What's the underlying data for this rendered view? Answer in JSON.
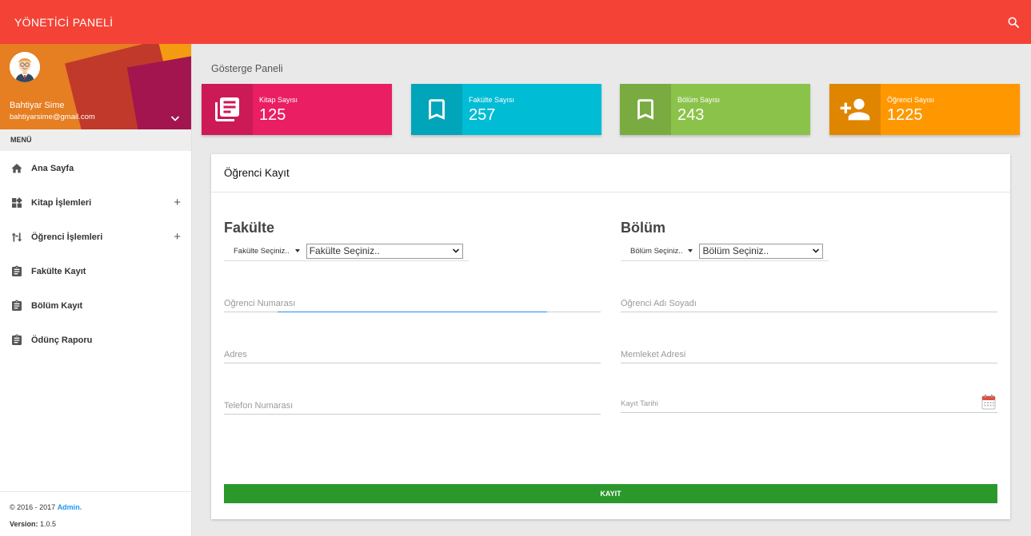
{
  "colors": {
    "topbar": "#f44336",
    "kitap": "#e91e63",
    "fakulte": "#00bcd4",
    "bolum": "#8bc34a",
    "ogrenci": "#ff9800",
    "button": "#2b982b",
    "link": "#2196f3"
  },
  "header": {
    "title": "YÖNETİCİ PANELİ",
    "search_icon": "search-icon"
  },
  "user": {
    "name": "Bahtiyar Sime",
    "email": "bahtiyarsime@gmail.com"
  },
  "menu": {
    "header": "MENÜ",
    "items": [
      {
        "label": "Ana Sayfa",
        "icon": "home-icon"
      },
      {
        "label": "Kitap İşlemleri",
        "icon": "widgets-icon",
        "expand": "+"
      },
      {
        "label": "Öğrenci İşlemleri",
        "icon": "swap-icon",
        "expand": "+"
      },
      {
        "label": "Fakülte Kayıt",
        "icon": "clipboard-icon"
      },
      {
        "label": "Bölüm Kayıt",
        "icon": "clipboard-icon"
      },
      {
        "label": "Ödünç Raporu",
        "icon": "clipboard-icon"
      }
    ]
  },
  "footer": {
    "copyright": "© 2016 - 2017 ",
    "link": "Admin.",
    "version_label": "Version: ",
    "version": "1.0.5"
  },
  "page_title": "Gösterge Paneli",
  "stats": [
    {
      "label": "Kitap Sayısı",
      "value": "125",
      "icon": "book-icon"
    },
    {
      "label": "Fakülte Sayısı",
      "value": "257",
      "icon": "bookmark-icon"
    },
    {
      "label": "Bölüm Sayısı",
      "value": "243",
      "icon": "bookmark-icon"
    },
    {
      "label": "Öğrenci Sayısı",
      "value": "1225",
      "icon": "person-add-icon"
    }
  ],
  "form": {
    "title": "Öğrenci Kayıt",
    "fakulte": {
      "title": "Fakülte",
      "bootstrap_select": "Fakülte Seçiniz..",
      "native_select": "Fakülte Seçiniz.."
    },
    "bolum": {
      "title": "Bölüm",
      "bootstrap_select": "Bölüm Seçiniz..",
      "native_select": "Bölüm Seçiniz.."
    },
    "fields": {
      "ogrenci_no": "Öğrenci Numarası",
      "ad_soyad": "Öğrenci Adı Soyadı",
      "adres": "Adres",
      "memleket": "Memleket Adresi",
      "telefon": "Telefon Numarası",
      "kayit_tarihi": "Kayıt Tarihi"
    },
    "submit": "KAYIT"
  }
}
